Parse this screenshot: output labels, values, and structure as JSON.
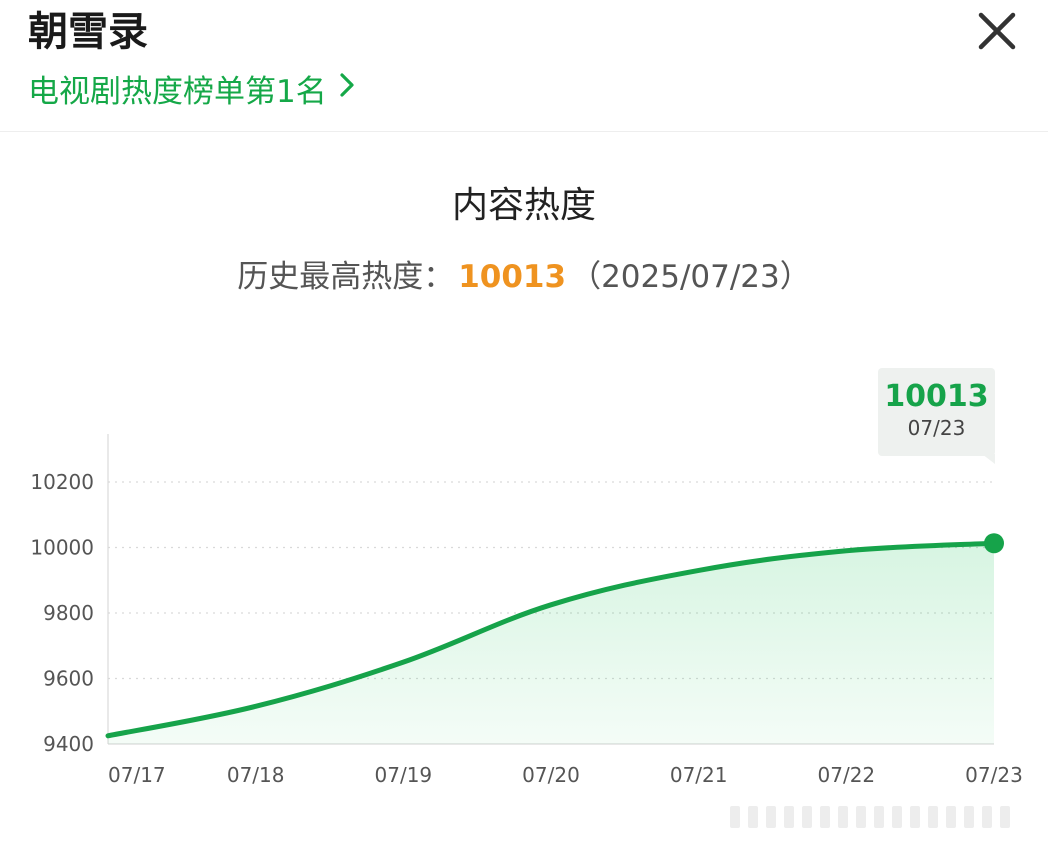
{
  "header": {
    "title": "朝雪录",
    "rank_text": "电视剧热度榜单第1名"
  },
  "chart_title": "内容热度",
  "record": {
    "label": "历史最高热度：",
    "value": "10013",
    "date": "（2025/07/23）"
  },
  "tooltip": {
    "value": "10013",
    "date": "07/23"
  },
  "colors": {
    "accent_green": "#16a34a",
    "record_orange": "#ef9320"
  },
  "chart_data": {
    "type": "area",
    "title": "内容热度",
    "categories": [
      "07/17",
      "07/18",
      "07/19",
      "07/20",
      "07/21",
      "07/22",
      "07/23"
    ],
    "values": [
      9425,
      9515,
      9650,
      9825,
      9930,
      9990,
      10013
    ],
    "yticks": [
      9400,
      9600,
      9800,
      10000,
      10200
    ],
    "ylim": [
      9400,
      10200
    ],
    "grid": true,
    "highlight_index": 6
  }
}
